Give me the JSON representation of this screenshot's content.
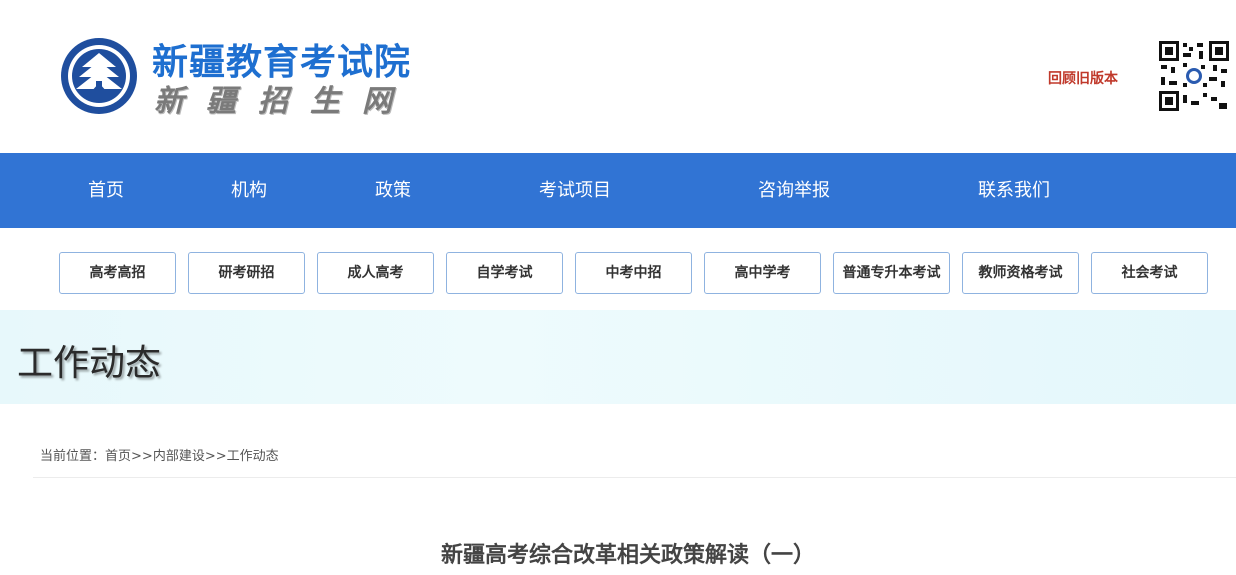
{
  "header": {
    "title": "新疆教育考试院",
    "subtitle": "新疆招生网",
    "old_version_link": "回顾旧版本",
    "logo_icon": "xinjiang-education-exam-emblem",
    "qr_icon": "qr-code"
  },
  "nav": {
    "items": [
      {
        "label": "首页"
      },
      {
        "label": "机构"
      },
      {
        "label": "政策"
      },
      {
        "label": "考试项目"
      },
      {
        "label": "咨询举报"
      },
      {
        "label": "联系我们"
      }
    ]
  },
  "subnav": {
    "items": [
      {
        "label": "高考高招"
      },
      {
        "label": "研考研招"
      },
      {
        "label": "成人高考"
      },
      {
        "label": "自学考试"
      },
      {
        "label": "中考中招"
      },
      {
        "label": "高中学考"
      },
      {
        "label": "普通专升本考试"
      },
      {
        "label": "教师资格考试"
      },
      {
        "label": "社会考试"
      }
    ]
  },
  "banner": {
    "title": "工作动态"
  },
  "breadcrumb": {
    "prefix": "当前位置：",
    "home": "首页",
    "sep1": ">>",
    "section": "内部建设",
    "sep2": ">>",
    "current": "工作动态"
  },
  "article": {
    "title": "新疆高考综合改革相关政策解读（一）"
  },
  "colors": {
    "nav_bg": "#3174d4",
    "title_blue": "#1e6fd0",
    "old_version_red": "#c0392b",
    "button_border": "#8fb3e0",
    "banner_bg": "#e7f8fb"
  }
}
